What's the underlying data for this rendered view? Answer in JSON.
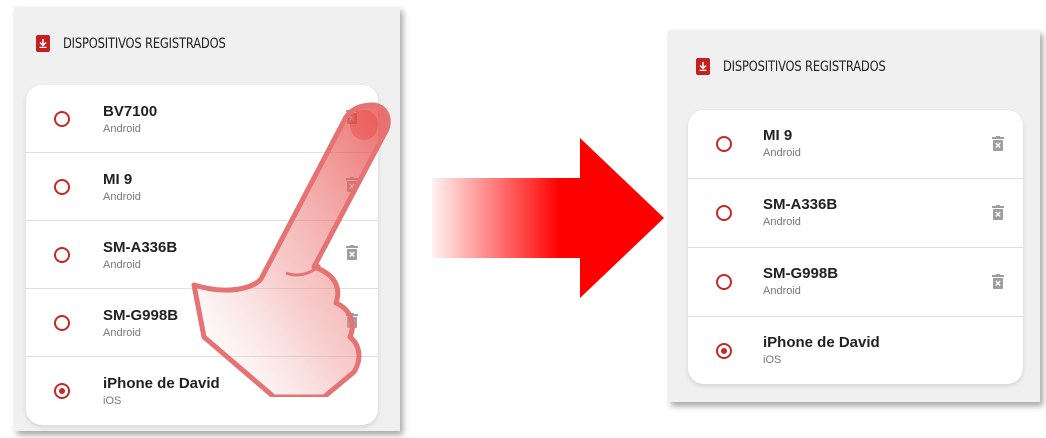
{
  "before": {
    "title": "DISPOSITIVOS REGISTRADOS",
    "devices": [
      {
        "name": "BV7100",
        "os": "Android",
        "selected": false
      },
      {
        "name": "MI 9",
        "os": "Android",
        "selected": false
      },
      {
        "name": "SM-A336B",
        "os": "Android",
        "selected": false
      },
      {
        "name": "SM-G998B",
        "os": "Android",
        "selected": false
      },
      {
        "name": "iPhone de David",
        "os": "iOS",
        "selected": true
      }
    ]
  },
  "after": {
    "title": "DISPOSITIVOS REGISTRADOS",
    "devices": [
      {
        "name": "MI 9",
        "os": "Android",
        "selected": false
      },
      {
        "name": "SM-A336B",
        "os": "Android",
        "selected": false
      },
      {
        "name": "SM-G998B",
        "os": "Android",
        "selected": false
      },
      {
        "name": "iPhone de David",
        "os": "iOS",
        "selected": true
      }
    ]
  },
  "colors": {
    "accent": "#c62828",
    "arrow": "#ff0000",
    "trash": "#9e9e9e"
  },
  "icons": {
    "header": "phone-download-icon",
    "delete": "trash-icon",
    "gesture": "tap-hand-icon",
    "transition": "right-arrow-icon"
  }
}
